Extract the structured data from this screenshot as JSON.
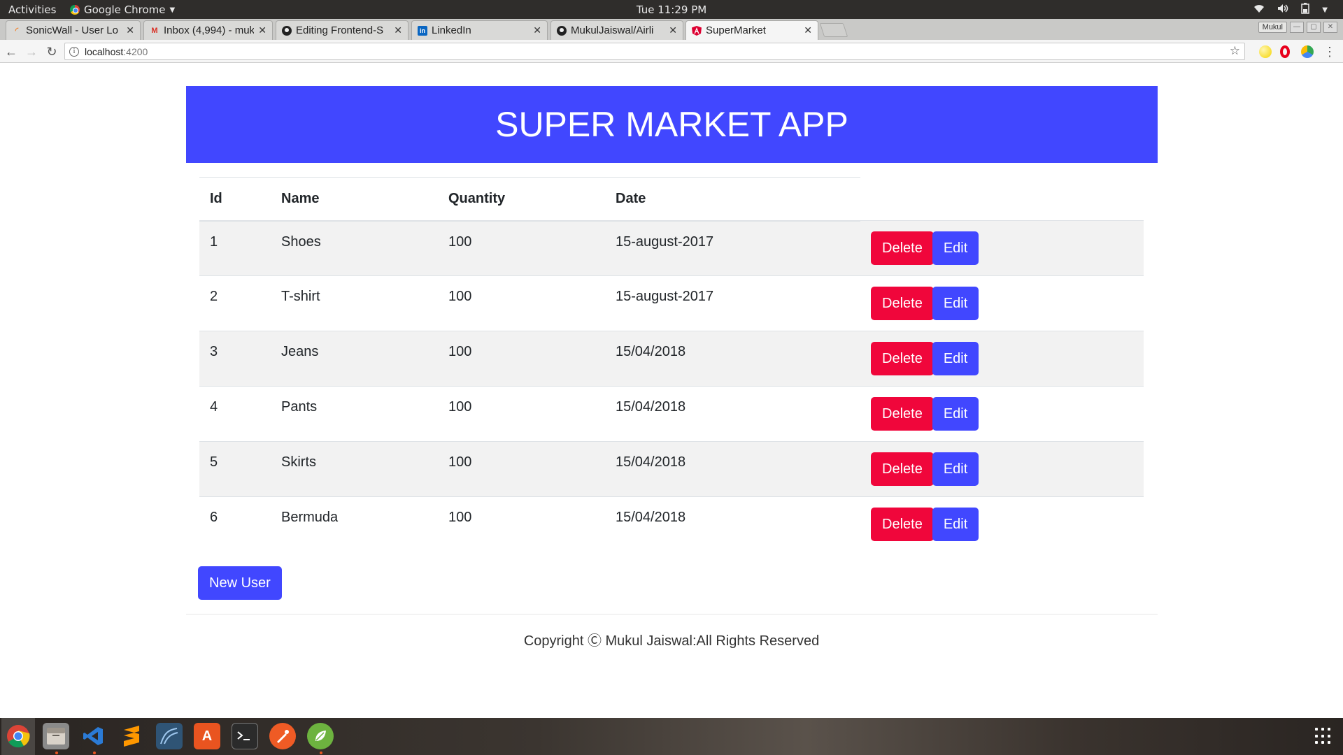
{
  "topbar": {
    "activities": "Activities",
    "app_name": "Google Chrome",
    "clock": "Tue 11:29 PM"
  },
  "tabs": [
    {
      "title": "SonicWall - User Lo",
      "icon": "sonicwall-icon",
      "color": "#f47c20"
    },
    {
      "title": "Inbox (4,994) - muk",
      "icon": "gmail-icon",
      "color": "#d93025"
    },
    {
      "title": "Editing Frontend-S",
      "icon": "github-icon",
      "color": "#222222"
    },
    {
      "title": "LinkedIn",
      "icon": "linkedin-icon",
      "color": "#0a66c2"
    },
    {
      "title": "MukulJaiswal/Airli",
      "icon": "github-icon",
      "color": "#222222"
    },
    {
      "title": "SuperMarket",
      "icon": "angular-icon",
      "color": "#dd0031"
    }
  ],
  "window": {
    "user": "Mukul"
  },
  "address": {
    "host": "localhost",
    "port": ":4200"
  },
  "app": {
    "title": "SUPER MARKET APP",
    "columns": [
      "Id",
      "Name",
      "Quantity",
      "Date"
    ],
    "rows": [
      {
        "id": "1",
        "name": "Shoes",
        "quantity": "100",
        "date": "15-august-2017"
      },
      {
        "id": "2",
        "name": "T-shirt",
        "quantity": "100",
        "date": "15-august-2017"
      },
      {
        "id": "3",
        "name": "Jeans",
        "quantity": "100",
        "date": "15/04/2018"
      },
      {
        "id": "4",
        "name": "Pants",
        "quantity": "100",
        "date": "15/04/2018"
      },
      {
        "id": "5",
        "name": "Skirts",
        "quantity": "100",
        "date": "15/04/2018"
      },
      {
        "id": "6",
        "name": "Bermuda",
        "quantity": "100",
        "date": "15/04/2018"
      }
    ],
    "delete_label": "Delete",
    "edit_label": "Edit",
    "new_user_label": "New User",
    "footer": "Copyright Ⓒ Mukul Jaiswal:All Rights Reserved",
    "colors": {
      "banner": "#4147ff",
      "delete": "#f0063b",
      "edit": "#4147ff"
    }
  },
  "dock": [
    {
      "name": "chrome-icon",
      "color": "#4285f4"
    },
    {
      "name": "files-icon",
      "color": "#8a8a8a"
    },
    {
      "name": "vscode-icon",
      "color": "#2b7bd6"
    },
    {
      "name": "sublime-icon",
      "color": "#ff9800"
    },
    {
      "name": "mysql-workbench-icon",
      "color": "#3d6f9e"
    },
    {
      "name": "software-center-icon",
      "color": "#e95420"
    },
    {
      "name": "terminal-icon",
      "color": "#2b2b2b"
    },
    {
      "name": "postman-icon",
      "color": "#ef5b25"
    },
    {
      "name": "spring-icon",
      "color": "#6db33f"
    }
  ]
}
